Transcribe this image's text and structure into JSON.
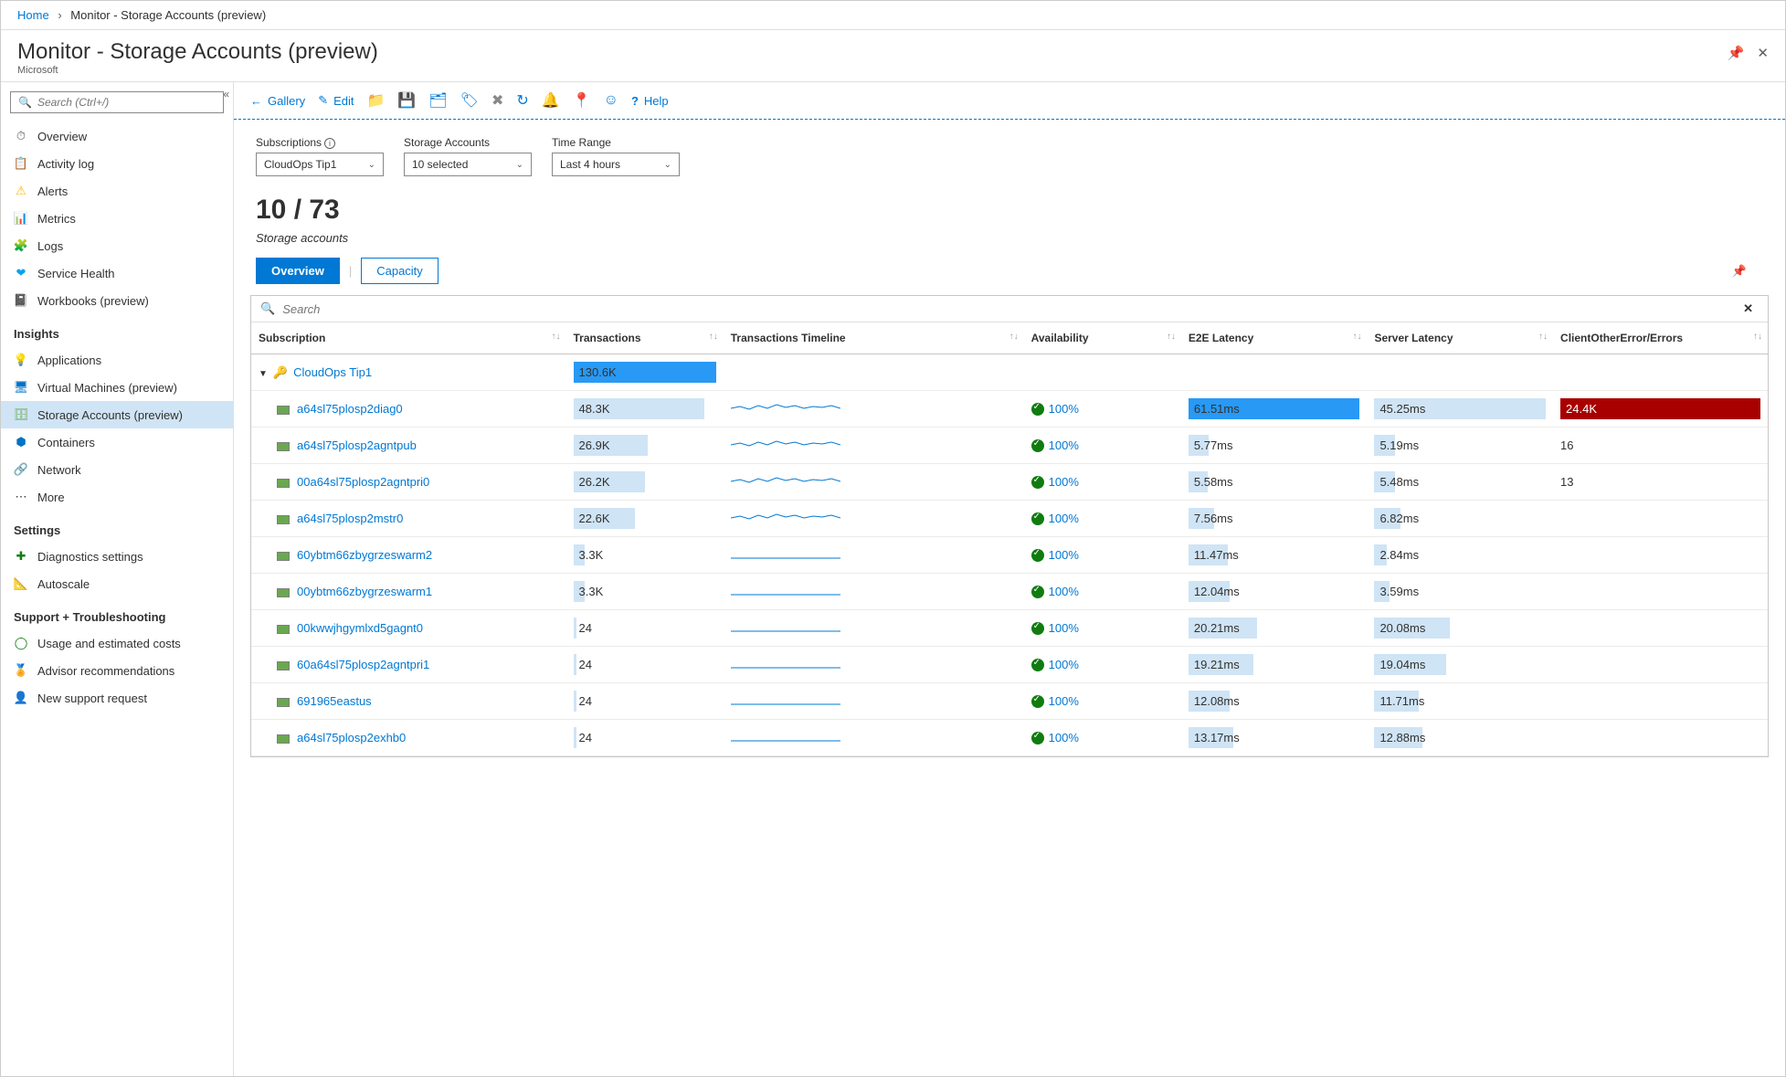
{
  "breadcrumb": {
    "home": "Home",
    "current": "Monitor - Storage Accounts (preview)"
  },
  "header": {
    "title": "Monitor - Storage Accounts (preview)",
    "subtitle": "Microsoft"
  },
  "sidebar": {
    "search_placeholder": "Search (Ctrl+/)",
    "top": [
      {
        "icon": "⏱",
        "color": "#605e5c",
        "label": "Overview"
      },
      {
        "icon": "📋",
        "color": "#0072c6",
        "label": "Activity log"
      },
      {
        "icon": "⚠",
        "color": "#ffb900",
        "label": "Alerts"
      },
      {
        "icon": "📊",
        "color": "#0072c6",
        "label": "Metrics"
      },
      {
        "icon": "🧩",
        "color": "#0072c6",
        "label": "Logs"
      },
      {
        "icon": "❤",
        "color": "#00a4ef",
        "label": "Service Health"
      },
      {
        "icon": "📓",
        "color": "#a0522d",
        "label": "Workbooks (preview)"
      }
    ],
    "insights_title": "Insights",
    "insights": [
      {
        "icon": "💡",
        "color": "#8661c5",
        "label": "Applications"
      },
      {
        "icon": "🖥",
        "color": "#0072c6",
        "label": "Virtual Machines (preview)"
      },
      {
        "icon": "🗄",
        "color": "#6aa84f",
        "label": "Storage Accounts (preview)",
        "active": true
      },
      {
        "icon": "⬢",
        "color": "#0072c6",
        "label": "Containers"
      },
      {
        "icon": "🔗",
        "color": "#323130",
        "label": "Network"
      },
      {
        "icon": "⋯",
        "color": "#323130",
        "label": "More"
      }
    ],
    "settings_title": "Settings",
    "settings": [
      {
        "icon": "✚",
        "color": "#107c10",
        "label": "Diagnostics settings"
      },
      {
        "icon": "📐",
        "color": "#605e5c",
        "label": "Autoscale"
      }
    ],
    "support_title": "Support + Troubleshooting",
    "support": [
      {
        "icon": "◯",
        "color": "#107c10",
        "label": "Usage and estimated costs"
      },
      {
        "icon": "🏅",
        "color": "#d83b01",
        "label": "Advisor recommendations"
      },
      {
        "icon": "👤",
        "color": "#0072c6",
        "label": "New support request"
      }
    ]
  },
  "toolbar": {
    "gallery": "Gallery",
    "edit": "Edit",
    "help": "Help"
  },
  "filters": {
    "subscriptions_label": "Subscriptions",
    "subscriptions_value": "CloudOps Tip1",
    "accounts_label": "Storage Accounts",
    "accounts_value": "10 selected",
    "timerange_label": "Time Range",
    "timerange_value": "Last 4 hours"
  },
  "summary": {
    "count": "10 / 73",
    "label": "Storage accounts"
  },
  "viewtabs": {
    "overview": "Overview",
    "capacity": "Capacity"
  },
  "grid": {
    "search_placeholder": "Search",
    "columns": [
      "Subscription",
      "Transactions",
      "Transactions Timeline",
      "Availability",
      "E2E Latency",
      "Server Latency",
      "ClientOtherError/Errors"
    ],
    "group": {
      "name": "CloudOps Tip1",
      "transactions": "130.6K"
    },
    "rows": [
      {
        "name": "a64sl75plosp2diag0",
        "tx": "48.3K",
        "txpct": 92,
        "avail": "100%",
        "e2e": "61.51ms",
        "e2epct": 100,
        "e2edark": true,
        "sl": "45.25ms",
        "slpct": 100,
        "err": "24.4K",
        "errbad": true,
        "spark": "strong"
      },
      {
        "name": "a64sl75plosp2agntpub",
        "tx": "26.9K",
        "txpct": 52,
        "avail": "100%",
        "e2e": "5.77ms",
        "e2epct": 12,
        "sl": "5.19ms",
        "slpct": 12,
        "err": "16",
        "spark": "strong"
      },
      {
        "name": "00a64sl75plosp2agntpri0",
        "tx": "26.2K",
        "txpct": 50,
        "avail": "100%",
        "e2e": "5.58ms",
        "e2epct": 11,
        "sl": "5.48ms",
        "slpct": 12,
        "err": "13",
        "spark": "strong"
      },
      {
        "name": "a64sl75plosp2mstr0",
        "tx": "22.6K",
        "txpct": 43,
        "avail": "100%",
        "e2e": "7.56ms",
        "e2epct": 15,
        "sl": "6.82ms",
        "slpct": 15,
        "err": "",
        "spark": "strong"
      },
      {
        "name": "60ybtm66zbygrzeswarm2",
        "tx": "3.3K",
        "txpct": 8,
        "avail": "100%",
        "e2e": "11.47ms",
        "e2epct": 23,
        "sl": "2.84ms",
        "slpct": 7,
        "err": "",
        "spark": "flat"
      },
      {
        "name": "00ybtm66zbygrzeswarm1",
        "tx": "3.3K",
        "txpct": 8,
        "avail": "100%",
        "e2e": "12.04ms",
        "e2epct": 24,
        "sl": "3.59ms",
        "slpct": 9,
        "err": "",
        "spark": "flat"
      },
      {
        "name": "00kwwjhgymlxd5gagnt0",
        "tx": "24",
        "txpct": 2,
        "avail": "100%",
        "e2e": "20.21ms",
        "e2epct": 40,
        "sl": "20.08ms",
        "slpct": 44,
        "err": "",
        "spark": "flat"
      },
      {
        "name": "60a64sl75plosp2agntpri1",
        "tx": "24",
        "txpct": 2,
        "avail": "100%",
        "e2e": "19.21ms",
        "e2epct": 38,
        "sl": "19.04ms",
        "slpct": 42,
        "err": "",
        "spark": "flat"
      },
      {
        "name": "691965eastus",
        "tx": "24",
        "txpct": 2,
        "avail": "100%",
        "e2e": "12.08ms",
        "e2epct": 24,
        "sl": "11.71ms",
        "slpct": 26,
        "err": "",
        "spark": "flat"
      },
      {
        "name": "a64sl75plosp2exhb0",
        "tx": "24",
        "txpct": 2,
        "avail": "100%",
        "e2e": "13.17ms",
        "e2epct": 26,
        "sl": "12.88ms",
        "slpct": 28,
        "err": "",
        "spark": "flat"
      }
    ]
  }
}
